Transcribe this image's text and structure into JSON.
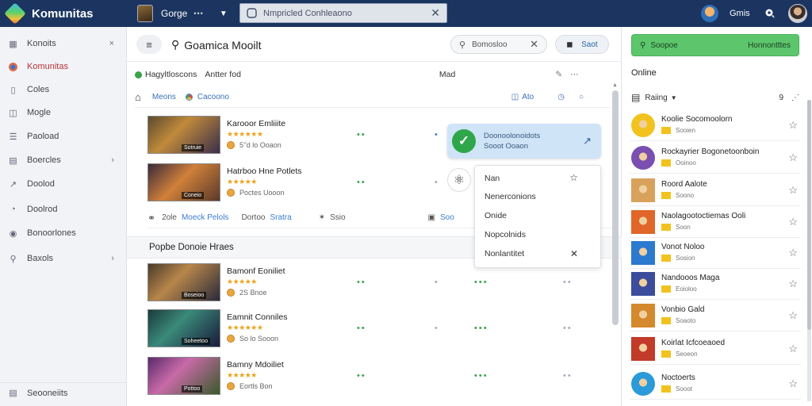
{
  "app": {
    "name": "Komunitas"
  },
  "topbar": {
    "game_label": "Gorge",
    "game_dots": "•••",
    "search_text": "Nmpricled Conhleaono",
    "user_name": "Gmis"
  },
  "sidebar": {
    "items": [
      {
        "label": "Konoits",
        "icon": "grid-icon",
        "chevron": "×"
      },
      {
        "label": "Komunitas",
        "icon": "globe-icon",
        "chevron": ""
      },
      {
        "label": "Coles",
        "icon": "book-icon",
        "chevron": ""
      },
      {
        "label": "Mogle",
        "icon": "library-icon",
        "chevron": ""
      },
      {
        "label": "Paoload",
        "icon": "list-icon",
        "chevron": ""
      },
      {
        "label": "Boercles",
        "icon": "tray-icon",
        "chevron": "›"
      },
      {
        "label": "Doolod",
        "icon": "arrow-icon",
        "chevron": ""
      },
      {
        "label": "Doolrod",
        "icon": "clock-icon",
        "chevron": ""
      },
      {
        "label": "Bonoorlones",
        "icon": "disc-icon",
        "chevron": ""
      },
      {
        "label": "Baxols",
        "icon": "search-icon",
        "chevron": "›"
      }
    ],
    "footer": "Seooneiits"
  },
  "main": {
    "title": "Goamica Mooilt",
    "search_text": "Bomosloo",
    "save_label": "Saot",
    "section": {
      "name": "Hagyltloscons",
      "col2": "Antter fod",
      "col3": "Mad"
    },
    "tabs": [
      {
        "label": "Meons"
      },
      {
        "label": "Cacoono"
      },
      {
        "label": "Ato"
      }
    ],
    "stats": {
      "count": "2ole",
      "link": "Moeck Pelols",
      "label3": "Dortoo",
      "link2": "Sratra",
      "label5": "Ssio",
      "label6": "Soo"
    },
    "popular_title": "Popbe Donoie Hraes"
  },
  "games": [
    {
      "name": "Karooor Emliiite",
      "stars": "★★★★★★",
      "meta": "5’'d lo Ooaon",
      "tag": "Sotruie"
    },
    {
      "name": "Hatrboo Hne Potlets",
      "stars": "★★★★★",
      "meta": "Poctes Uooon",
      "tag": "Coneio"
    }
  ],
  "popular": [
    {
      "name": "Bamonf Eoniliet",
      "stars": "★★★★★",
      "meta": "2S Bnoe",
      "tag": "Boseioo"
    },
    {
      "name": "Eamnit Conniles",
      "stars": "★★★★★★",
      "meta": "So lo Sooon",
      "tag": "Soheetoo"
    },
    {
      "name": "Bamny Mdoiliet",
      "stars": "★★★★★",
      "meta": "Eortls Bon",
      "tag": "Pottoo"
    }
  ],
  "notification": {
    "line1": "Doonoolonoidots",
    "line2": "Sooot Ooaon"
  },
  "menu": {
    "items": [
      "Nan",
      "Nenerconions",
      "Onide",
      "Nopcolnids",
      "Nonlantitet"
    ]
  },
  "right": {
    "search_placeholder": "Soopoe",
    "search_right": "Honnontttes",
    "online_label": "Online",
    "sort_label": "Raiing",
    "sort_count": "9",
    "users": [
      {
        "name": "Koolie Socomoolorn",
        "sub": "Sooien",
        "color": "#f2c21f"
      },
      {
        "name": "Rockayrier Bogonetoonboin",
        "sub": "Ooinoo",
        "color": "#7a4fb0"
      },
      {
        "name": "Roord Aalote",
        "sub": "Soono",
        "color": "#d8a25c"
      },
      {
        "name": "Naolagootoctiemas Ooli",
        "sub": "Soon",
        "color": "#e0662a"
      },
      {
        "name": "Vonot Noloo",
        "sub": "Sosion",
        "color": "#2c7ad0"
      },
      {
        "name": "Nandooos Maga",
        "sub": "Eoioloo",
        "color": "#3b4c9c"
      },
      {
        "name": "Vonbio Gald",
        "sub": "Soaoto",
        "color": "#d4892e"
      },
      {
        "name": "Koirlat Icfcoeaoed",
        "sub": "Seoeon",
        "color": "#c23a2a"
      },
      {
        "name": "Noctoerts",
        "sub": "Sooot",
        "color": "#2a9ad8"
      }
    ]
  }
}
